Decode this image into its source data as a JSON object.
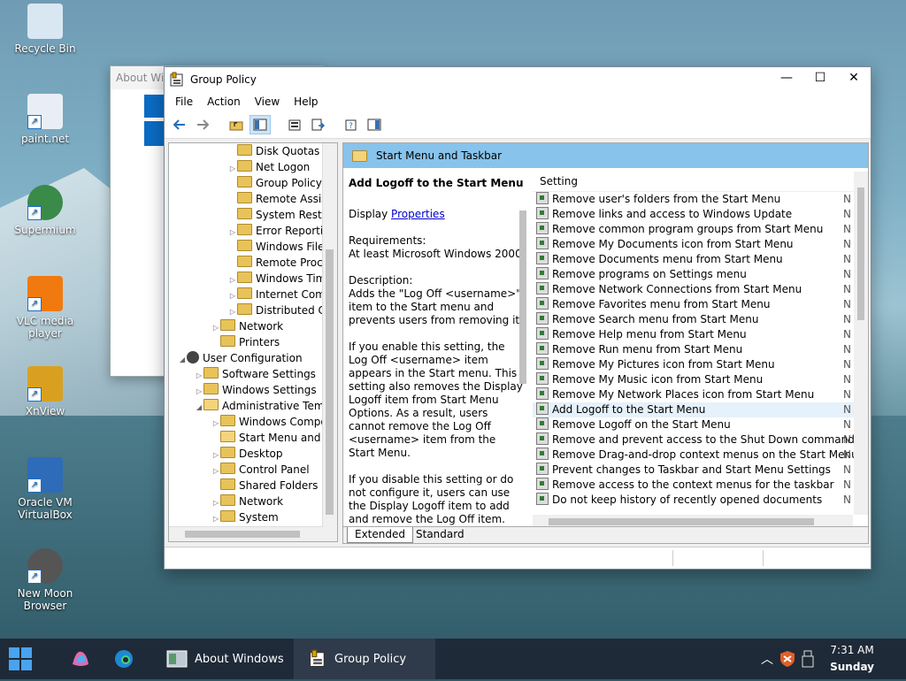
{
  "desktop_icons": [
    {
      "label": "Recycle Bin",
      "icon": "recycle-bin-icon"
    },
    {
      "label": "paint.net",
      "icon": "paint-net-icon"
    },
    {
      "label": "Supermium",
      "icon": "supermium-icon"
    },
    {
      "label": "VLC media player",
      "icon": "vlc-icon"
    },
    {
      "label": "XnView",
      "icon": "xnview-icon"
    },
    {
      "label": "Oracle VM VirtualBox",
      "icon": "virtualbox-icon"
    },
    {
      "label": "New Moon Browser",
      "icon": "new-moon-icon"
    }
  ],
  "about_window": {
    "title": "About Wi"
  },
  "window": {
    "title": "Group Policy",
    "menu": [
      "File",
      "Action",
      "View",
      "Help"
    ]
  },
  "tree": [
    {
      "label": "Disk Quotas",
      "indent": 3,
      "expander": ""
    },
    {
      "label": "Net Logon",
      "indent": 3,
      "expander": "▷"
    },
    {
      "label": "Group Policy",
      "indent": 3,
      "expander": ""
    },
    {
      "label": "Remote Assistance",
      "indent": 3,
      "expander": ""
    },
    {
      "label": "System Restore",
      "indent": 3,
      "expander": ""
    },
    {
      "label": "Error Reporting",
      "indent": 3,
      "expander": "▷"
    },
    {
      "label": "Windows File Protection",
      "indent": 3,
      "expander": ""
    },
    {
      "label": "Remote Procedure Call",
      "indent": 3,
      "expander": ""
    },
    {
      "label": "Windows Time Service",
      "indent": 3,
      "expander": "▷"
    },
    {
      "label": "Internet Communication",
      "indent": 3,
      "expander": "▷"
    },
    {
      "label": "Distributed COM",
      "indent": 3,
      "expander": "▷"
    },
    {
      "label": "Network",
      "indent": 2,
      "expander": "▷"
    },
    {
      "label": "Printers",
      "indent": 2,
      "expander": ""
    },
    {
      "label": "User Configuration",
      "indent": 0,
      "expander": "◢",
      "kind": "user"
    },
    {
      "label": "Software Settings",
      "indent": 1,
      "expander": "▷"
    },
    {
      "label": "Windows Settings",
      "indent": 1,
      "expander": "▷"
    },
    {
      "label": "Administrative Templates",
      "indent": 1,
      "expander": "◢",
      "open": true
    },
    {
      "label": "Windows Components",
      "indent": 2,
      "expander": "▷"
    },
    {
      "label": "Start Menu and Taskbar",
      "indent": 2,
      "expander": "",
      "open": true
    },
    {
      "label": "Desktop",
      "indent": 2,
      "expander": "▷"
    },
    {
      "label": "Control Panel",
      "indent": 2,
      "expander": "▷"
    },
    {
      "label": "Shared Folders",
      "indent": 2,
      "expander": ""
    },
    {
      "label": "Network",
      "indent": 2,
      "expander": "▷"
    },
    {
      "label": "System",
      "indent": 2,
      "expander": "▷"
    }
  ],
  "header": {
    "title": "Start Menu and Taskbar"
  },
  "description": {
    "title": "Add Logoff to the Start Menu",
    "display_prefix": "Display ",
    "properties_link": "Properties",
    "requirements_label": "Requirements:",
    "requirements": "At least Microsoft Windows 2000",
    "description_label": "Description:",
    "p1": "Adds the \"Log Off <username>\" item to the Start menu and prevents users from removing it.",
    "p2": "If you enable this setting, the Log Off <username> item appears in the Start menu. This setting also removes the Display Logoff item from Start Menu Options. As a result, users cannot remove the Log Off <username> item from the Start Menu.",
    "p3": "If you disable this setting or do not configure it, users can use the Display Logoff item to add and remove the Log Off item."
  },
  "settings_list": {
    "column_header": "Setting",
    "trailing": "N",
    "rows": [
      "Remove user's folders from the Start Menu",
      "Remove links and access to Windows Update",
      "Remove common program groups from Start Menu",
      "Remove My Documents icon from Start Menu",
      "Remove Documents menu from Start Menu",
      "Remove programs on Settings menu",
      "Remove Network Connections from Start Menu",
      "Remove Favorites menu from Start Menu",
      "Remove Search menu from Start Menu",
      "Remove Help menu from Start Menu",
      "Remove Run menu from Start Menu",
      "Remove My Pictures icon from Start Menu",
      "Remove My Music icon from Start Menu",
      "Remove My Network Places icon from Start Menu",
      "Add Logoff to the Start Menu",
      "Remove Logoff on the Start Menu",
      "Remove and prevent access to the Shut Down command",
      "Remove Drag-and-drop context menus on the Start Menu",
      "Prevent changes to Taskbar and Start Menu Settings",
      "Remove access to the context menus for the taskbar",
      "Do not keep history of recently opened documents"
    ],
    "selected_index": 14
  },
  "tabs": [
    "Extended",
    "Standard"
  ],
  "taskbar": {
    "items": [
      {
        "label": "About Windows"
      },
      {
        "label": "Group Policy"
      }
    ],
    "time": "7:31 AM",
    "day": "Sunday"
  },
  "colors": {
    "header_bg": "#87c3ea",
    "accent": "#0a6cc4"
  }
}
